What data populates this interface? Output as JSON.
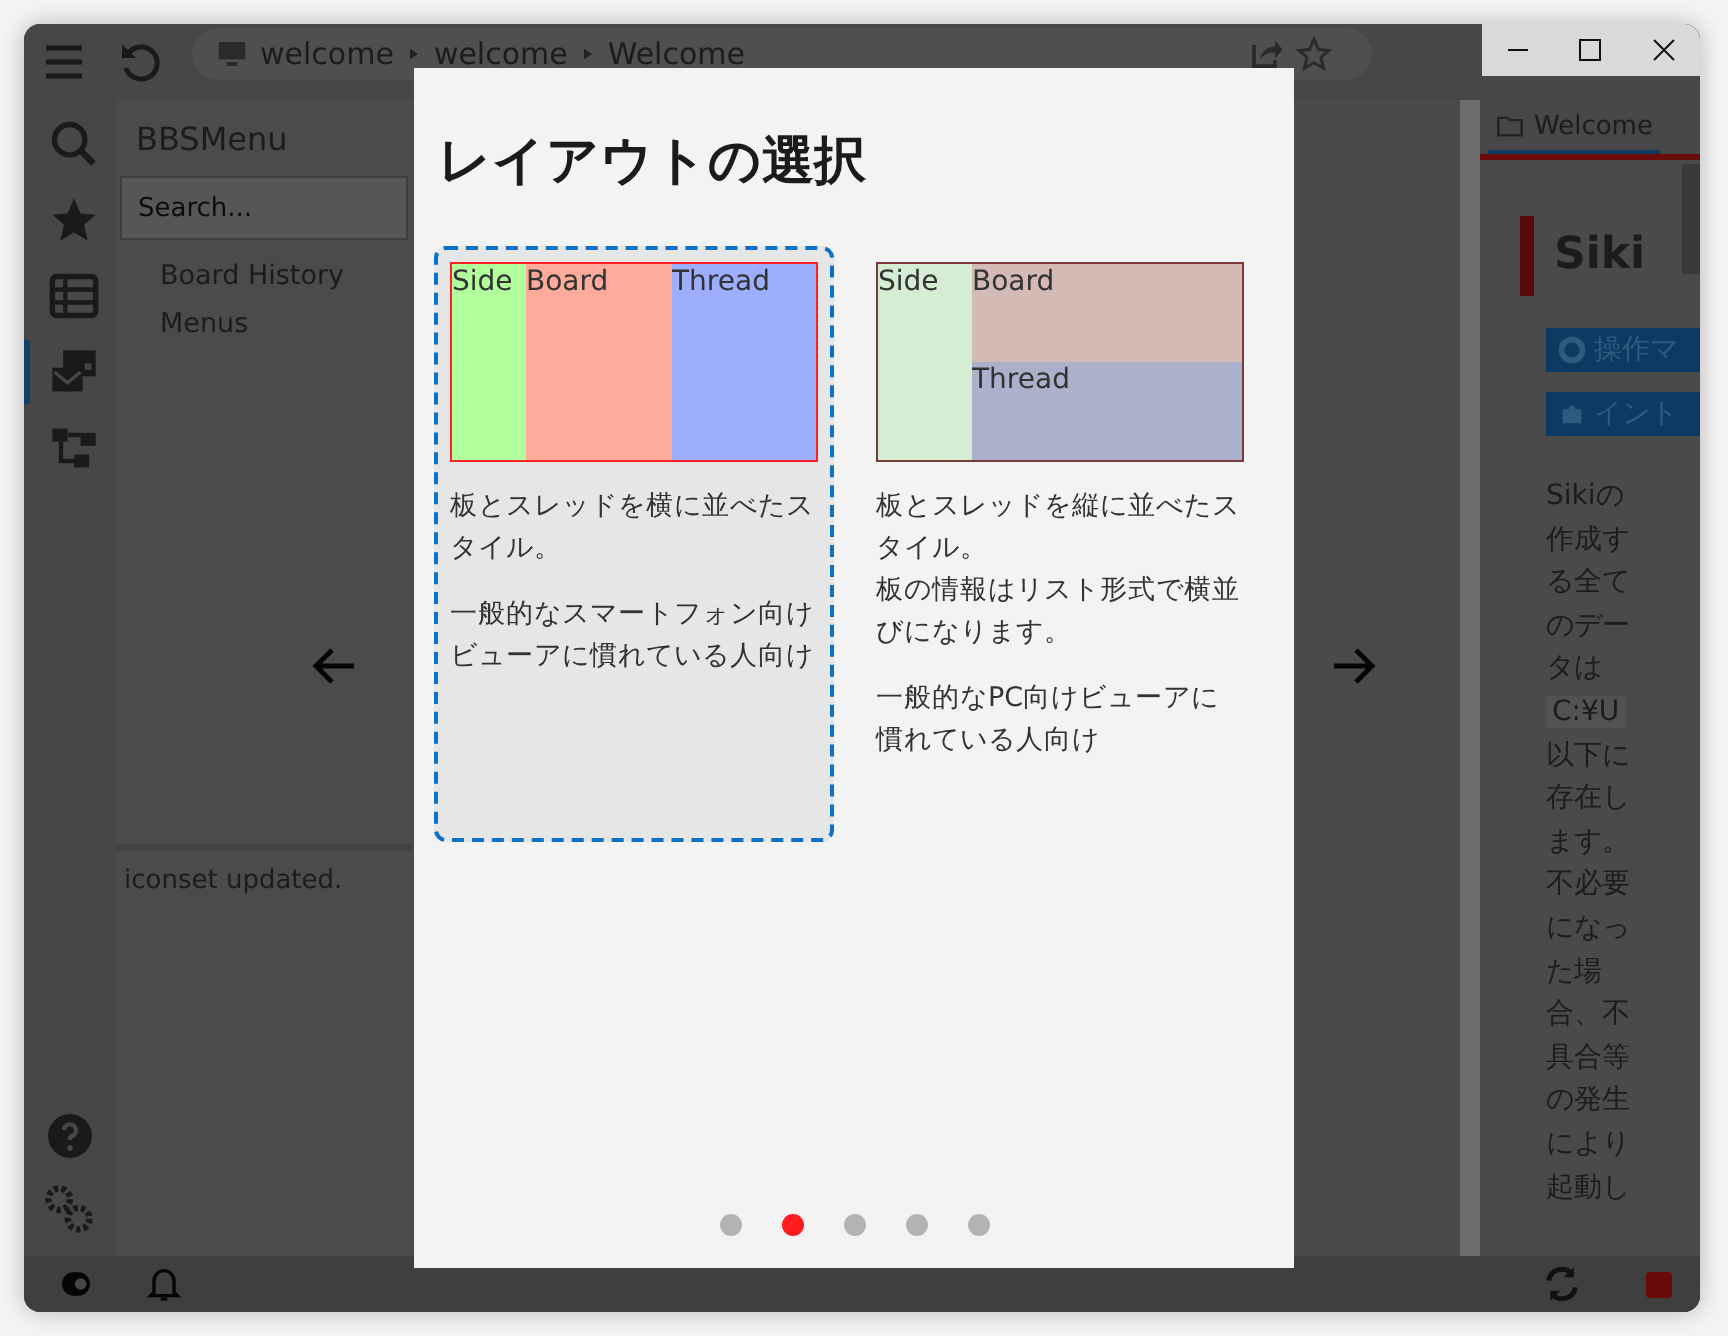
{
  "toolbar": {
    "breadcrumb": [
      "welcome",
      "welcome",
      "Welcome"
    ]
  },
  "rail": [
    {
      "kind": "search",
      "selected": false
    },
    {
      "kind": "star",
      "selected": false
    },
    {
      "kind": "list",
      "selected": false
    },
    {
      "kind": "mail",
      "selected": true
    },
    {
      "kind": "tree",
      "selected": false
    }
  ],
  "sidebar": {
    "title": "BBSMenu",
    "search": {
      "placeholder": "Search..."
    },
    "items": [
      {
        "label": "Board History"
      },
      {
        "label": "Menus"
      }
    ]
  },
  "log": [
    "iconset updated."
  ],
  "dialog": {
    "title": "レイアウトの選択",
    "options": [
      {
        "kind": "horizontal",
        "selected": true,
        "panes": [
          {
            "label": "Side",
            "color": "#b2ff9e"
          },
          {
            "label": "Board",
            "color": "#ffab9b"
          },
          {
            "label": "Thread",
            "color": "#9daeff"
          }
        ],
        "paragraphs": [
          [
            "板とスレッドを横に並べたスタイル。"
          ],
          [
            "一般的なスマートフォン向けビューアに慣れている人向け"
          ]
        ]
      },
      {
        "kind": "vertical",
        "selected": false,
        "panes": [
          {
            "label": "Side",
            "color": "#d5edd3"
          },
          {
            "label": "Board",
            "color": "#d3bab5"
          },
          {
            "label": "Thread",
            "color": "#abb0cb"
          }
        ],
        "paragraphs": [
          [
            "板とスレッドを縦に並べたスタイル。",
            "板の情報はリスト形式で横並びになります。"
          ],
          [
            "一般的なPC向けビューアに慣れている人向け"
          ]
        ]
      }
    ],
    "pages": [
      {
        "selected": false
      },
      {
        "selected": true
      },
      {
        "selected": false
      },
      {
        "selected": false
      },
      {
        "selected": false
      }
    ]
  },
  "right_panel": {
    "tab": {
      "label": "Welcome",
      "selected": true
    },
    "heading": "Siki",
    "buttons": [
      {
        "kind": "help",
        "label": "操作マ"
      },
      {
        "kind": "plugin",
        "label": "イント"
      }
    ],
    "body": {
      "before": "Sikiの作成する全てのデータは",
      "path": "C:¥U",
      "after": "以下に存在します。不必要になった場合、不具合等の発生により起動し"
    }
  }
}
